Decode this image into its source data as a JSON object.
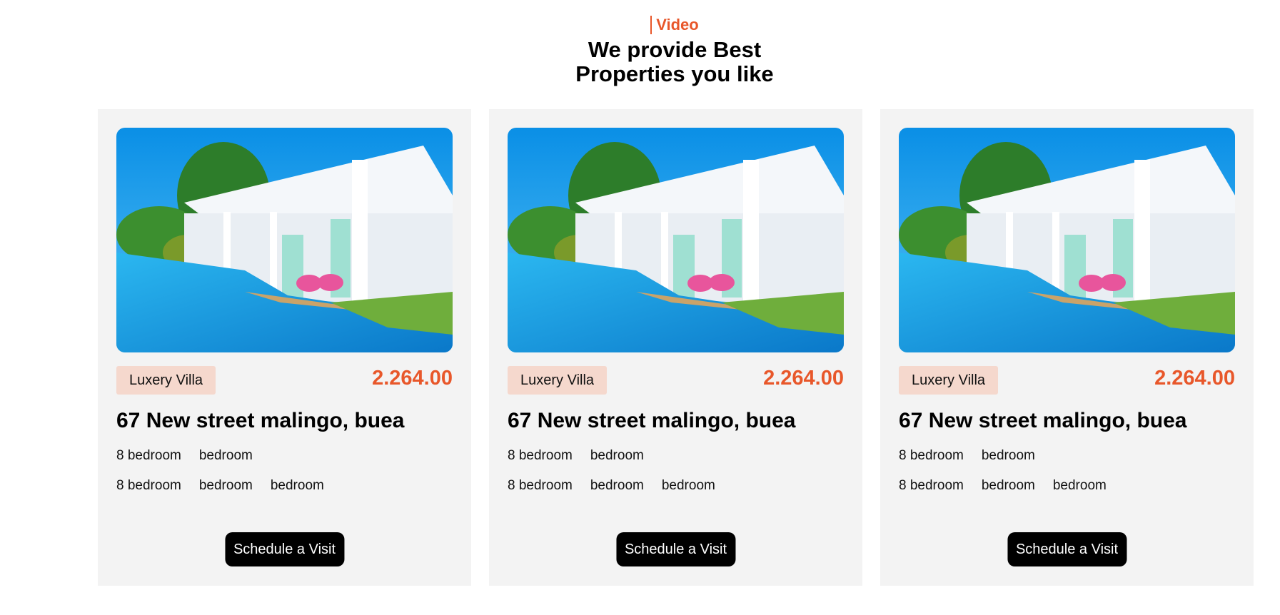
{
  "header": {
    "eyebrow": "Video",
    "headline": "We provide Best Properties you like"
  },
  "image_description": "villa-pool-photo",
  "colors": {
    "accent": "#e8572a",
    "tag_bg": "#f5d8cd",
    "card_bg": "#f3f3f3",
    "button_bg": "#000000"
  },
  "cards": [
    {
      "tag": "Luxery Villa",
      "price": "2.264.00",
      "address": "67 New street malingo, buea",
      "features_row1": [
        "8 bedroom",
        "bedroom"
      ],
      "features_row2": [
        "8 bedroom",
        "bedroom",
        "bedroom"
      ],
      "cta": "Schedule a Visit"
    },
    {
      "tag": "Luxery Villa",
      "price": "2.264.00",
      "address": "67 New street malingo, buea",
      "features_row1": [
        "8 bedroom",
        "bedroom"
      ],
      "features_row2": [
        "8 bedroom",
        "bedroom",
        "bedroom"
      ],
      "cta": "Schedule a Visit"
    },
    {
      "tag": "Luxery Villa",
      "price": "2.264.00",
      "address": "67 New street malingo, buea",
      "features_row1": [
        "8 bedroom",
        "bedroom"
      ],
      "features_row2": [
        "8 bedroom",
        "bedroom",
        "bedroom"
      ],
      "cta": "Schedule a Visit"
    }
  ]
}
